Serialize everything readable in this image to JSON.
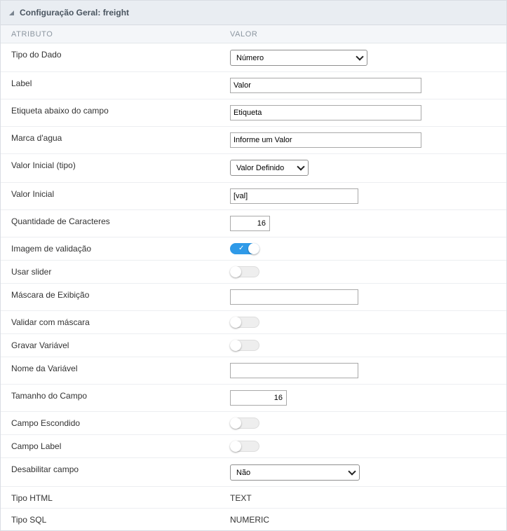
{
  "panel": {
    "title": "Configuração Geral: freight"
  },
  "columns": {
    "attribute": "ATRIBUTO",
    "value": "VALOR"
  },
  "fields": {
    "tipo_dado": {
      "label": "Tipo do Dado",
      "value": "Número"
    },
    "label": {
      "label": "Label",
      "value": "Valor"
    },
    "etiqueta": {
      "label": "Etiqueta abaixo do campo",
      "value": "Etiqueta"
    },
    "marca": {
      "label": "Marca d'agua",
      "value": "Informe um Valor"
    },
    "valor_inicial_tipo": {
      "label": "Valor Inicial (tipo)",
      "value": "Valor Definido"
    },
    "valor_inicial": {
      "label": "Valor Inicial",
      "value": "[val]"
    },
    "qtd_caracteres": {
      "label": "Quantidade de Caracteres",
      "value": "16"
    },
    "imagem_validacao": {
      "label": "Imagem de validação",
      "on": true
    },
    "usar_slider": {
      "label": "Usar slider",
      "on": false
    },
    "mascara_exibicao": {
      "label": "Máscara de Exibição",
      "value": ""
    },
    "validar_mascara": {
      "label": "Validar com máscara",
      "on": false
    },
    "gravar_variavel": {
      "label": "Gravar Variável",
      "on": false
    },
    "nome_variavel": {
      "label": "Nome da Variável",
      "value": ""
    },
    "tamanho_campo": {
      "label": "Tamanho do Campo",
      "value": "16"
    },
    "campo_escondido": {
      "label": "Campo Escondido",
      "on": false
    },
    "campo_label": {
      "label": "Campo Label",
      "on": false
    },
    "desabilitar_campo": {
      "label": "Desabilitar campo",
      "value": "Não"
    },
    "tipo_html": {
      "label": "Tipo HTML",
      "value": "TEXT"
    },
    "tipo_sql": {
      "label": "Tipo SQL",
      "value": "NUMERIC"
    }
  },
  "colors": {
    "toggle_on": "#2f9ae8",
    "header_bg": "#e9edf2"
  }
}
